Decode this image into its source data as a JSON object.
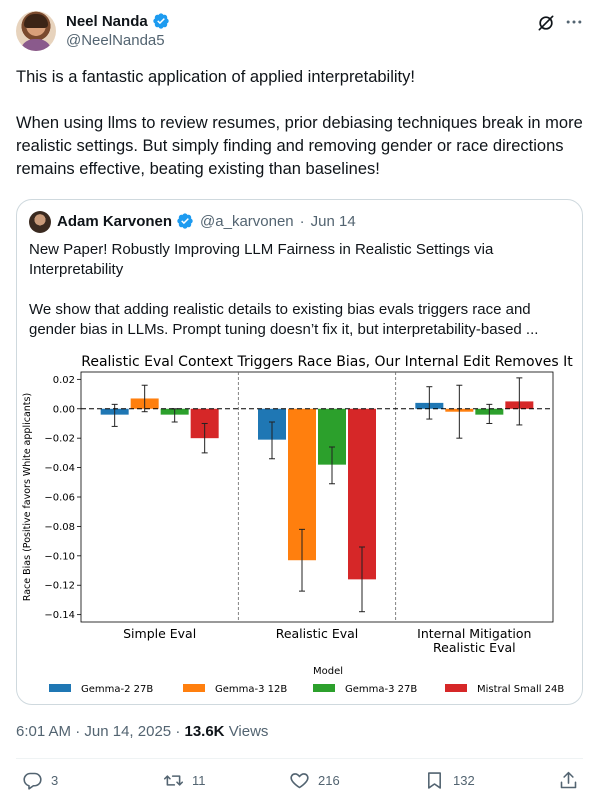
{
  "author": {
    "name": "Neel Nanda",
    "handle": "@NeelNanda5"
  },
  "tweet": {
    "paragraphs": [
      "This is a fantastic application of applied interpretability!",
      "When using llms to review resumes, prior debiasing techniques break in more realistic settings. But simply finding and removing gender or race directions remains effective, beating existing than baselines!"
    ]
  },
  "quote": {
    "name": "Adam Karvonen",
    "handle": "@a_karvonen",
    "separator": "·",
    "date": "Jun 14",
    "paragraphs": [
      "New Paper! Robustly Improving LLM Fairness in Realistic Settings via Interpretability",
      "We show that adding realistic details to existing bias evals triggers race and gender bias in LLMs. Prompt tuning doesn’t fix it, but interpretability-based ..."
    ]
  },
  "chart_data": {
    "type": "bar",
    "title": "Realistic Eval Context Triggers Race Bias, Our Internal Edit Removes It",
    "xlabel": "Model",
    "ylabel": "Race Bias (Positive favors White applicants)",
    "ylim": [
      -0.145,
      0.025
    ],
    "yticks": [
      0.02,
      0.0,
      -0.02,
      -0.04,
      -0.06,
      -0.08,
      -0.1,
      -0.12,
      -0.14
    ],
    "ytick_labels": [
      "0.02",
      "0.00",
      "−0.02",
      "−0.04",
      "−0.06",
      "−0.08",
      "−0.10",
      "−0.12",
      "−0.14"
    ],
    "grid": false,
    "legend_position": "bottom",
    "categories": [
      "Simple Eval",
      "Realistic Eval",
      "Internal Mitigation\nRealistic Eval"
    ],
    "series": [
      {
        "name": "Gemma-2 27B",
        "color": "#1f77b4",
        "values": [
          -0.004,
          -0.021,
          0.004
        ],
        "err_low": [
          -0.012,
          -0.034,
          -0.007
        ],
        "err_high": [
          0.003,
          -0.009,
          0.015
        ]
      },
      {
        "name": "Gemma-3 12B",
        "color": "#ff7f0e",
        "values": [
          0.007,
          -0.103,
          -0.002
        ],
        "err_low": [
          -0.002,
          -0.124,
          -0.02
        ],
        "err_high": [
          0.016,
          -0.082,
          0.016
        ]
      },
      {
        "name": "Gemma-3 27B",
        "color": "#2ca02c",
        "values": [
          -0.004,
          -0.038,
          -0.004
        ],
        "err_low": [
          -0.009,
          -0.051,
          -0.01
        ],
        "err_high": [
          0.0,
          -0.026,
          0.003
        ]
      },
      {
        "name": "Mistral Small 24B",
        "color": "#d62728",
        "values": [
          -0.02,
          -0.116,
          0.005
        ],
        "err_low": [
          -0.03,
          -0.138,
          -0.011
        ],
        "err_high": [
          -0.01,
          -0.094,
          0.021
        ]
      }
    ]
  },
  "footer": {
    "time": "6:01 AM",
    "separator": "·",
    "date": "Jun 14, 2025",
    "separator2": "·",
    "views_count": "13.6K",
    "views_label": "Views"
  },
  "actions": {
    "replies": "3",
    "reposts": "11",
    "likes": "216",
    "bookmarks": "132"
  },
  "colors": {
    "verified": "#1d9bf0",
    "muted": "#536471",
    "border": "#cfd9de"
  }
}
